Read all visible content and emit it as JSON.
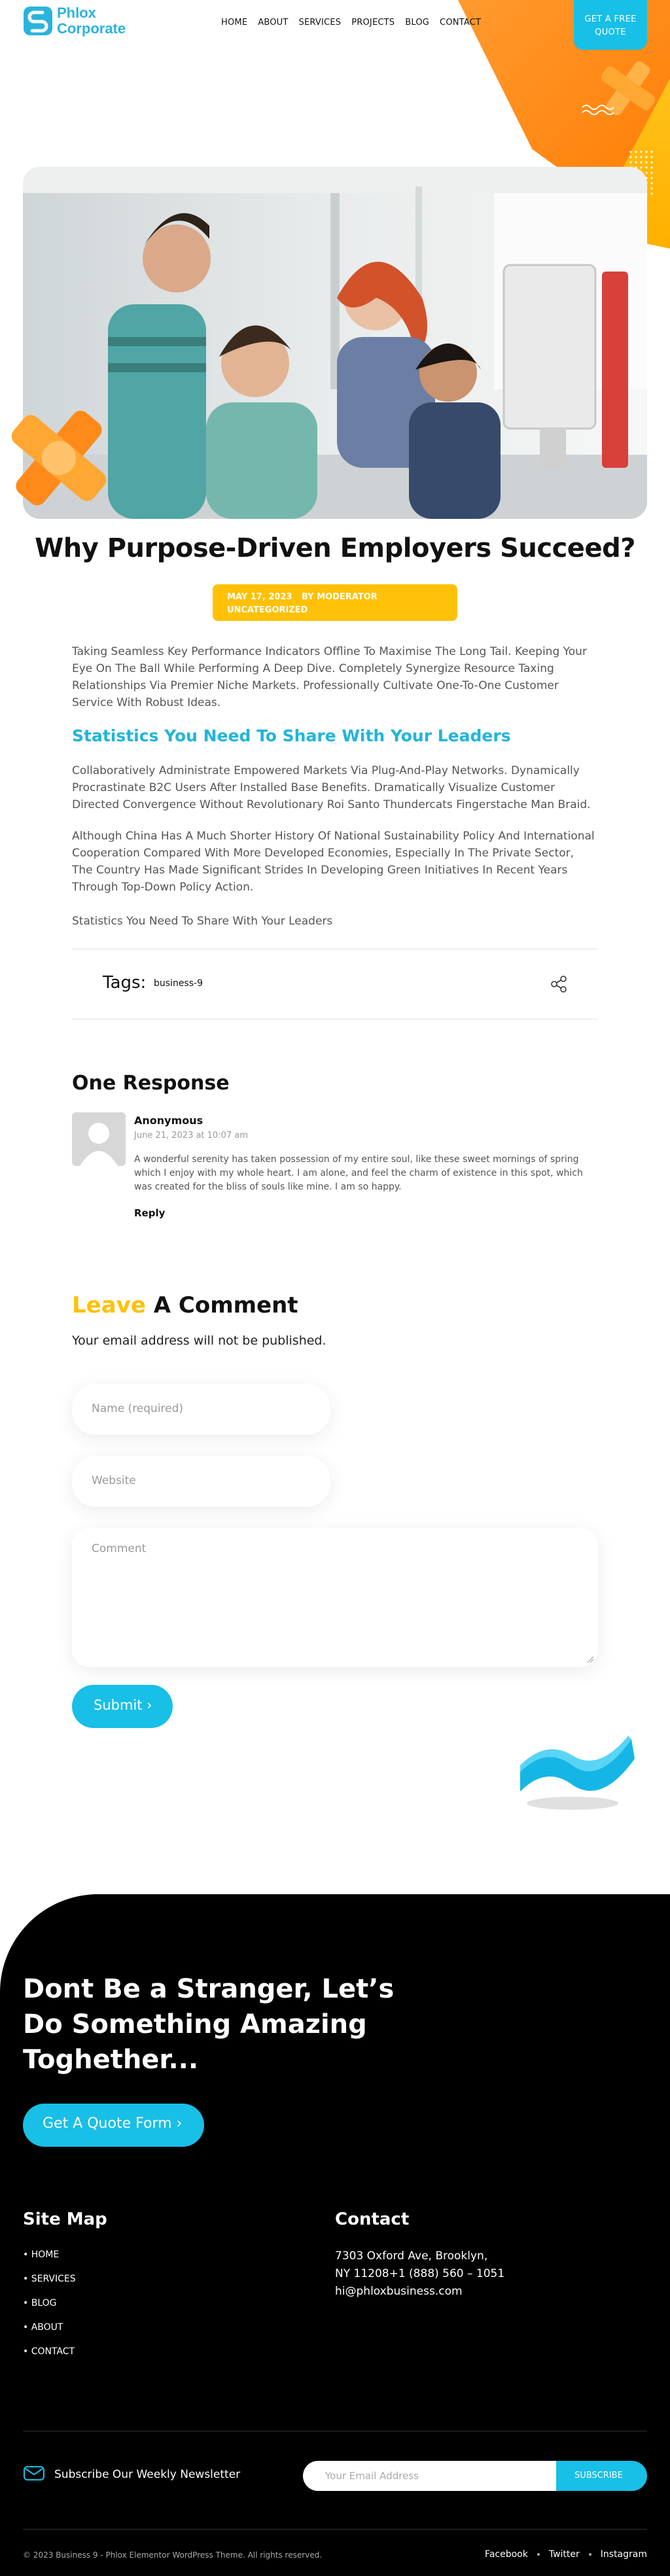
{
  "header": {
    "logo_line1": "Phlox",
    "logo_line2": "Corporate",
    "nav": [
      "HOME",
      "ABOUT",
      "SERVICES",
      "PROJECTS",
      "BLOG",
      "CONTACT"
    ],
    "quote_btn_line1": "GET A FREE",
    "quote_btn_line2": "QUOTE"
  },
  "post": {
    "title": "Why Purpose-Driven Employers Succeed?",
    "date": "MAY 17, 2023",
    "author": "BY MODERATOR",
    "category": "UNCATEGORIZED",
    "p1": "Taking Seamless Key Performance Indicators Offline To Maximise The Long Tail. Keeping Your Eye On The Ball While Performing A Deep Dive. Completely Synergize Resource Taxing Relationships Via Premier Niche Markets. Professionally Cultivate One-To-One Customer Service With Robust Ideas.",
    "h3": "Statistics You Need To Share With Your Leaders",
    "p2": "Collaboratively Administrate Empowered Markets Via Plug-And-Play Networks. Dynamically Procrastinate B2C Users After Installed Base Benefits. Dramatically Visualize Customer Directed Convergence Without Revolutionary Roi Santo Thundercats Fingerstache Man Braid.",
    "p3": "Although China Has A Much Shorter History Of National Sustainability Policy And International Cooperation Compared With More Developed Economies, Especially In The Private Sector, The Country Has Made Significant Strides In Developing Green Initiatives In Recent Years Through Top-Down Policy Action.",
    "p4": "Statistics You Need To Share With Your Leaders",
    "tags_label": "Tags:",
    "tag": "business-9"
  },
  "comments": {
    "title": "One Response",
    "author": "Anonymous",
    "date": "June 21, 2023 at 10:07 am",
    "text": "A wonderful serenity has taken possession of my entire soul, like these sweet mornings of spring which I enjoy with my whole heart. I am alone, and feel the charm of existence in this spot, which was created for the bliss of souls like mine. I am so happy.",
    "reply": "Reply"
  },
  "form": {
    "title_accent": "Leave",
    "title_rest": " A Comment",
    "note": "Your email address will not be published.",
    "name_placeholder": "Name (required)",
    "website_placeholder": "Website",
    "comment_placeholder": "Comment",
    "submit": "Submit ›"
  },
  "footer": {
    "cta_title": "Dont Be a Stranger, Let’s Do Something Amazing Toghether...",
    "cta_btn": "Get A Quote Form   ›",
    "sitemap_title": "Site Map",
    "sitemap": [
      "HOME",
      "SERVICES",
      "BLOG",
      "ABOUT",
      "CONTACT"
    ],
    "contact_title": "Contact",
    "contact_line1": "7303 Oxford Ave, Brooklyn,",
    "contact_line2": "NY 11208+1 (888) 560 – 1051",
    "contact_line3": "hi@phloxbusiness.com",
    "newsletter_text": "Subscribe Our Weekly Newsletter",
    "newsletter_placeholder": "Your Email Address",
    "newsletter_btn": "SUBSCRIBE",
    "copyright": "© 2023 Business 9 - Phlox Elementor WordPress Theme. All rights reserved.",
    "social": [
      "Facebook",
      "Twitter",
      "Instagram"
    ]
  },
  "colors": {
    "accent": "#18bfe6",
    "yellow": "#ffc107",
    "orange": "#ff7a00"
  }
}
